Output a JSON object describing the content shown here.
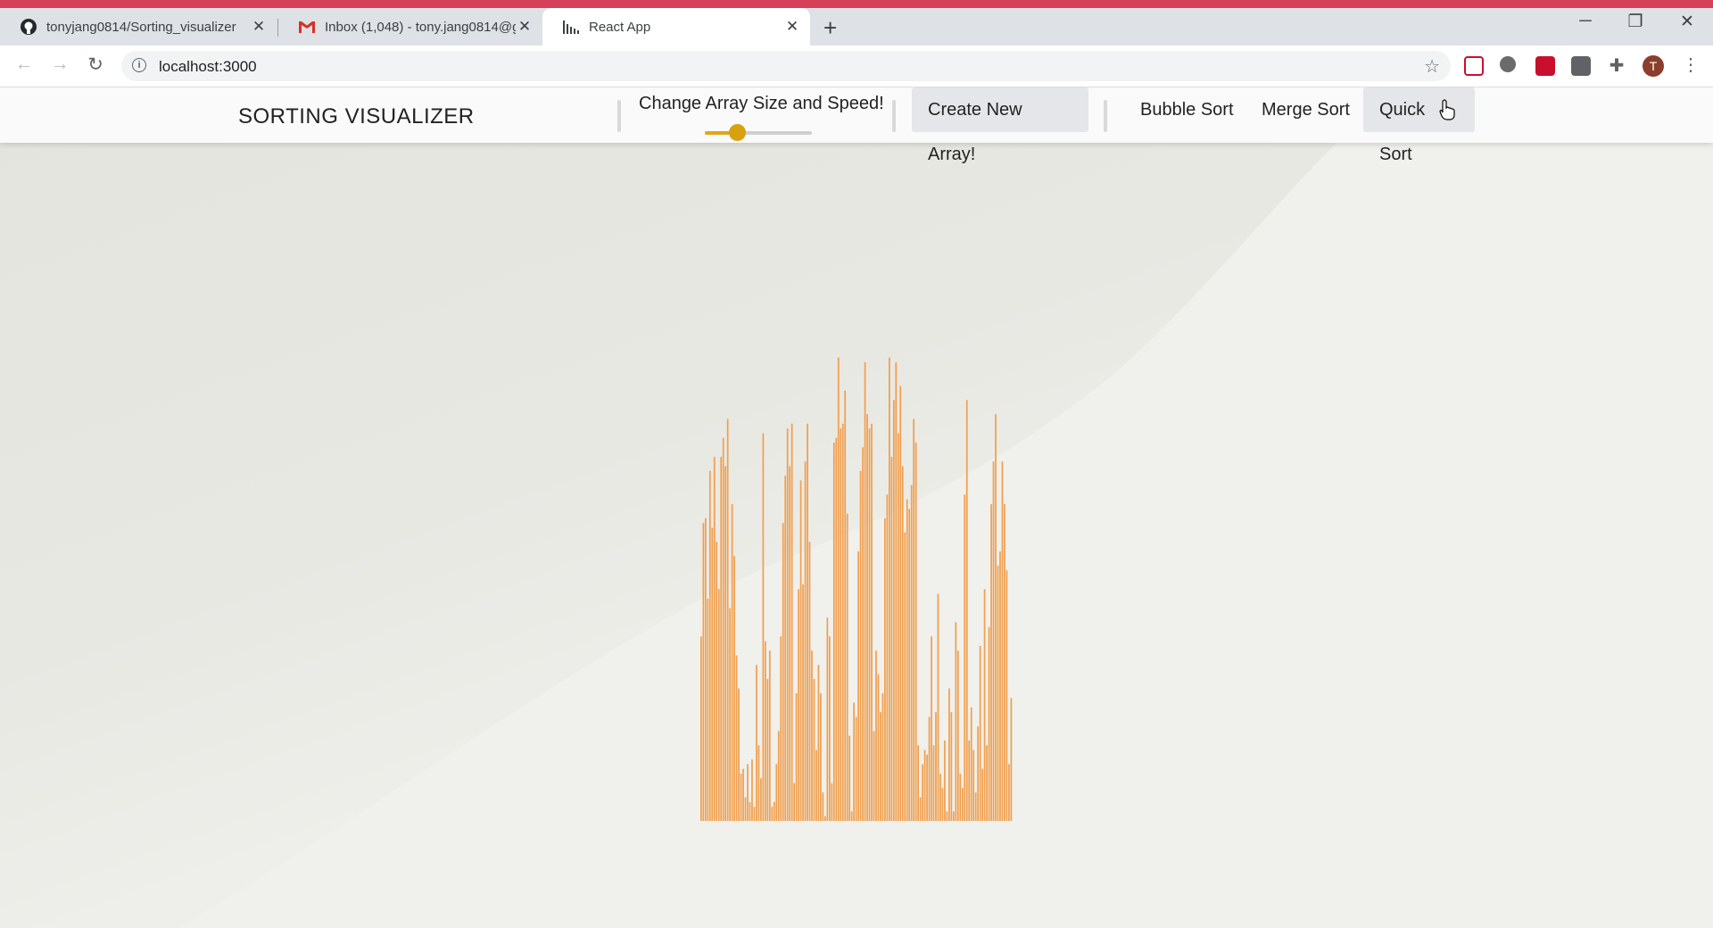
{
  "colors": {
    "bar": "#f0a050",
    "accent_strip": "#d6415a",
    "slider": "#d8a20e"
  },
  "browser": {
    "tabs": [
      {
        "title": "tonyjang0814/Sorting_visualizer",
        "icon": "github-icon",
        "active": false
      },
      {
        "title": "Inbox (1,048) - tony.jang0814@g",
        "icon": "gmail-icon",
        "active": false
      },
      {
        "title": "React App",
        "icon": "chart-icon",
        "active": true
      }
    ],
    "new_tab": "+",
    "url": "localhost:3000",
    "avatar_initial": "T"
  },
  "app": {
    "brand": "SORTING VISUALIZER",
    "size_label": "Change Array Size and Speed!",
    "slider_value": 0.3,
    "buttons": {
      "create": "Create New Array!",
      "bubble": "Bubble Sort",
      "merge": "Merge Sort",
      "quick": "Quick Sort"
    }
  },
  "chart_data": {
    "type": "bar",
    "values": [
      39,
      63,
      64,
      47,
      74,
      62,
      77,
      59,
      49,
      77,
      81,
      75,
      85,
      45,
      67,
      56,
      35,
      28,
      10,
      11,
      5,
      12,
      4,
      13,
      3,
      33,
      16,
      9,
      82,
      38,
      30,
      36,
      3,
      4,
      12,
      19,
      39,
      63,
      73,
      83,
      75,
      84,
      8,
      27,
      49,
      72,
      50,
      76,
      84,
      59,
      36,
      30,
      15,
      33,
      27,
      6,
      1,
      43,
      39,
      8,
      80,
      81,
      98,
      83,
      84,
      91,
      65,
      18,
      2,
      25,
      22,
      57,
      74,
      79,
      97,
      86,
      83,
      84,
      19,
      36,
      31,
      23,
      27,
      64,
      69,
      98,
      77,
      89,
      97,
      82,
      92,
      75,
      61,
      68,
      66,
      71,
      85,
      80,
      16,
      5,
      12,
      15,
      14,
      22,
      39,
      16,
      23,
      48,
      10,
      7,
      17,
      2,
      28,
      23,
      2,
      42,
      36,
      10,
      7,
      69,
      89,
      17,
      24,
      15,
      6,
      20,
      37,
      11,
      49,
      16,
      41,
      67,
      76,
      86,
      54,
      57,
      76,
      67,
      53,
      12,
      26
    ]
  }
}
